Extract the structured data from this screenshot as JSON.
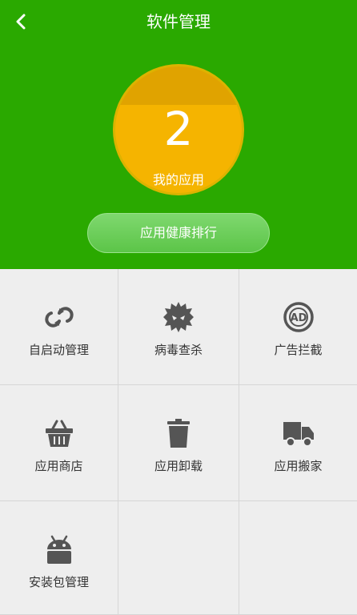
{
  "header": {
    "title": "软件管理",
    "count": "2",
    "count_label": "我的应用",
    "rank_button": "应用健康排行"
  },
  "grid": {
    "items": [
      {
        "label": "自启动管理",
        "icon": "autostart-icon"
      },
      {
        "label": "病毒查杀",
        "icon": "virus-scan-icon"
      },
      {
        "label": "广告拦截",
        "icon": "ad-block-icon"
      },
      {
        "label": "应用商店",
        "icon": "app-store-basket-icon"
      },
      {
        "label": "应用卸载",
        "icon": "uninstall-trash-icon"
      },
      {
        "label": "应用搬家",
        "icon": "app-move-truck-icon"
      },
      {
        "label": "安装包管理",
        "icon": "apk-android-icon"
      }
    ]
  },
  "colors": {
    "header_green": "#2aa900",
    "circle_yellow": "#f5b400",
    "icon_gray": "#555555"
  }
}
